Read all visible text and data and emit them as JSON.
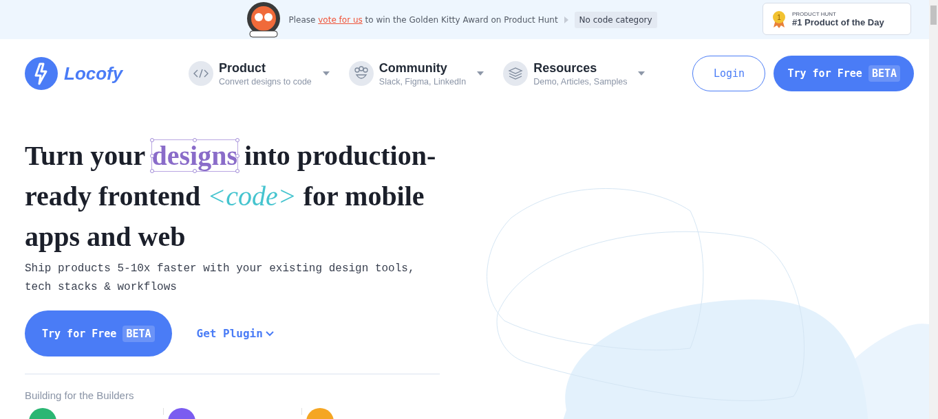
{
  "banner": {
    "text_before": "Please ",
    "link": "vote for us",
    "text_after": " to win the Golden Kitty Award on Product Hunt",
    "tag": "No code category",
    "award": {
      "kicker": "PRODUCT HUNT",
      "title": "#1 Product of the Day",
      "rank": "1"
    }
  },
  "nav": {
    "logo": "Locofy",
    "menus": [
      {
        "title": "Product",
        "subtitle": "Convert designs to code",
        "kind": "code"
      },
      {
        "title": "Community",
        "subtitle": "Slack, Figma, LinkedIn",
        "kind": "people"
      },
      {
        "title": "Resources",
        "subtitle": "Demo, Articles, Samples",
        "kind": "stack"
      }
    ],
    "login": "Login",
    "cta": {
      "label": "Try for Free",
      "badge": "BETA"
    }
  },
  "hero": {
    "headline": [
      {
        "text": "Turn your ",
        "kind": "plain"
      },
      {
        "text": "designs",
        "kind": "selected"
      },
      {
        "text": " into production-ready frontend ",
        "kind": "plain"
      },
      {
        "text": "<code>",
        "kind": "code"
      },
      {
        "text": " for mobile apps and web",
        "kind": "plain"
      }
    ],
    "subtitle": "Ship products 5-10x faster with your existing design tools, tech stacks & workflows",
    "cta": {
      "label": "Try for Free",
      "badge": "BETA"
    },
    "plugin": "Get Plugin",
    "builders": "Building for the Builders",
    "builder_dots": [
      {
        "color": "#2bb673"
      },
      {
        "color": "#7b5cf0"
      },
      {
        "color": "#f5a623"
      }
    ]
  }
}
